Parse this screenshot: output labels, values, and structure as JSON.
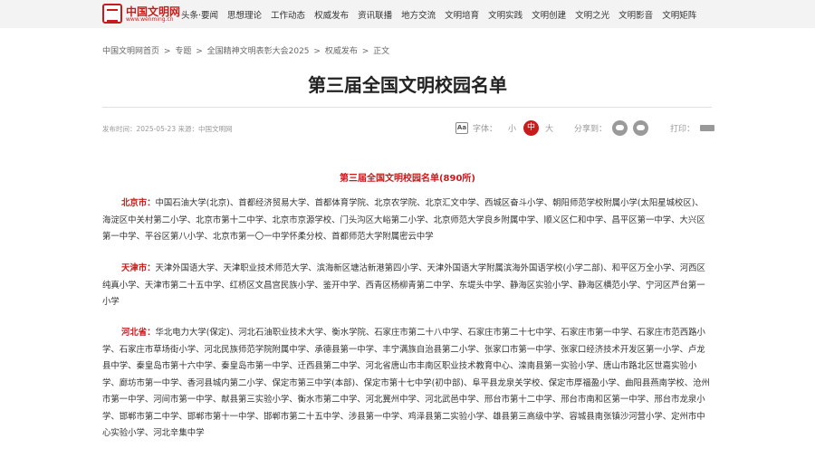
{
  "site": {
    "logo_name": "中国文明网",
    "logo_url": "www.wenming.cn",
    "nav": [
      "头条·要闻",
      "思想理论",
      "工作动态",
      "权威发布",
      "资讯联播",
      "地方交流",
      "文明培育",
      "文明实践",
      "文明创建",
      "文明之光",
      "文明影音",
      "文明矩阵"
    ]
  },
  "breadcrumb": [
    "中国文明网首页",
    "专题",
    "全国精神文明表彰大会2025",
    "权威发布",
    "正文"
  ],
  "breadcrumb_sep": ">",
  "article": {
    "title": "第三届全国文明校园名单",
    "meta": "发布时间：2025-05-23 来源：中国文明网",
    "font_label": "字体：",
    "font_small": "小",
    "font_medium": "中",
    "font_large": "大",
    "share_label": "分享到：",
    "print_label": "打印：",
    "subtitle": "第三届全国文明校园名单(890所)",
    "sections": [
      {
        "province": "北京市：",
        "text": "中国石油大学(北京)、首都经济贸易大学、首都体育学院、北京农学院、北京汇文中学、西城区奋斗小学、朝阳师范学校附属小学(太阳星城校区)、海淀区中关村第二小学、北京市第十二中学、北京市京源学校、门头沟区大峪第二小学、北京师范大学良乡附属中学、顺义区仁和中学、昌平区第一中学、大兴区第一中学、平谷区第八小学、北京市第一〇一中学怀柔分校、首都师范大学附属密云中学"
      },
      {
        "province": "天津市：",
        "text": "天津外国语大学、天津职业技术师范大学、滨海新区塘沽新港第四小学、天津外国语大学附属滨海外国语学校(小学二部)、和平区万全小学、河西区纯真小学、天津市第二十五中学、红桥区文昌宫民族小学、鉴开中学、西青区杨柳青第二中学、东堤头中学、静海区实验小学、静海区横范小学、宁河区芦台第一小学"
      },
      {
        "province": "河北省：",
        "text": "华北电力大学(保定)、河北石油职业技术大学、衡水学院、石家庄市第二十八中学、石家庄市第二十七中学、石家庄市第一中学、石家庄市范西路小学、石家庄市草场街小学、河北民族师范学院附属中学、承德县第一中学、丰宁满族自治县第二小学、张家口市第一中学、张家口经济技术开发区第一小学、卢龙县中学、秦皇岛市第十六中学、秦皇岛市第一中学、迁西县第二中学、河北省唐山市丰南区职业技术教育中心、滦南县第一实验小学、唐山市路北区世嘉实验小学、廊坊市第一中学、香河县城内第二小学、保定市第三中学(本部)、保定市第十七中学(初中部)、阜平县龙泉关学校、保定市厚福盈小学、曲阳县燕南学校、沧州市第一中学、河间市第一中学、献县第三实验小学、衡水市第二中学、河北冀州中学、河北武邑中学、邢台市第十二中学、邢台市南和区第一中学、邢台市龙泉小学、邯郸市第二中学、邯郸市第十一中学、邯郸市第二十五中学、涉县第一中学、鸡泽县第二实验小学、雄县第三高级中学、容城县南张镇沙河营小学、定州市中心实验小学、河北辛集中学"
      }
    ]
  },
  "colors": {
    "accent": "#c81c1c",
    "topbar": "#f3f3f3"
  }
}
